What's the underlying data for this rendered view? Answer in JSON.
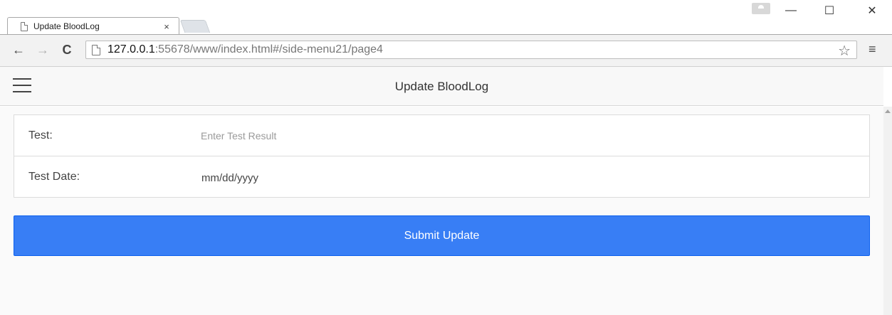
{
  "browser": {
    "tab_title": "Update BloodLog",
    "tab_close": "×",
    "url_host": "127.0.0.1",
    "url_rest": ":55678/www/index.html#/side-menu21/page4",
    "window_min": "—",
    "window_max": "☐",
    "window_close": "✕",
    "back": "←",
    "forward": "→",
    "reload": "C",
    "bookmark": "☆",
    "menu": "≡"
  },
  "header": {
    "title": "Update BloodLog"
  },
  "form": {
    "test_label": "Test:",
    "test_placeholder": "Enter Test Result",
    "test_value": "",
    "date_label": "Test Date:",
    "date_value": "mm/dd/yyyy"
  },
  "submit_label": "Submit Update",
  "colors": {
    "submit_bg": "#387ef5",
    "header_bg": "#f8f8f8"
  }
}
